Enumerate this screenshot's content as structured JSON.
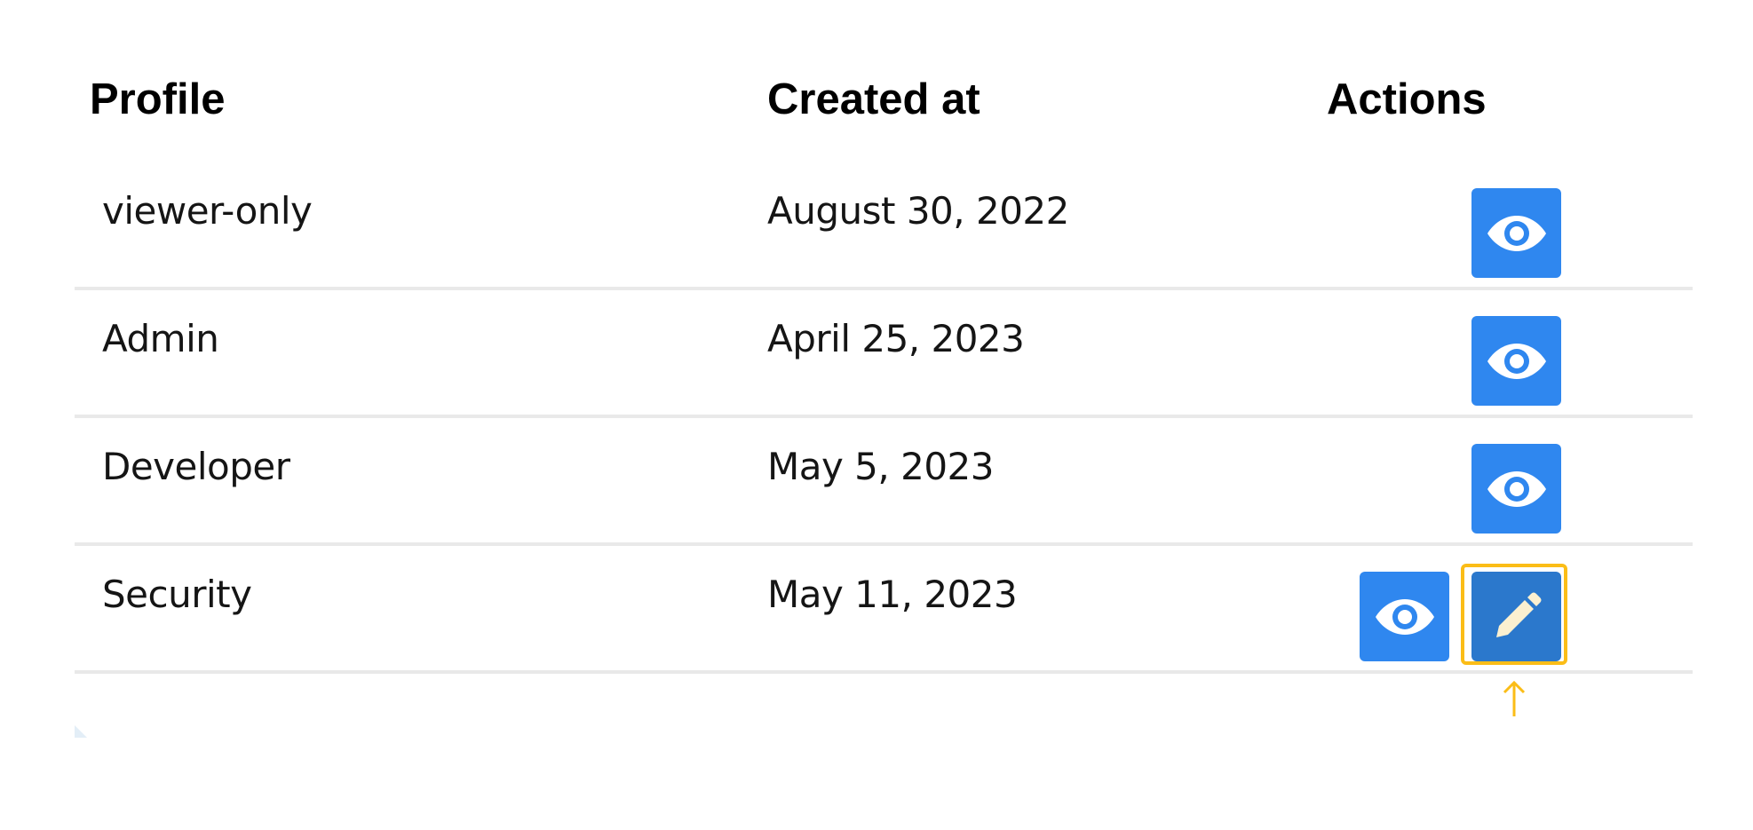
{
  "table": {
    "headers": {
      "profile": "Profile",
      "created_at": "Created at",
      "actions": "Actions"
    },
    "rows": [
      {
        "profile": "viewer-only",
        "created_at": "August 30, 2022",
        "actions": [
          "view"
        ]
      },
      {
        "profile": "Admin",
        "created_at": "April 25, 2023",
        "actions": [
          "view"
        ]
      },
      {
        "profile": "Developer",
        "created_at": "May 5, 2023",
        "actions": [
          "view"
        ]
      },
      {
        "profile": "Security",
        "created_at": "May 11, 2023",
        "actions": [
          "view",
          "edit"
        ]
      }
    ]
  },
  "icons": {
    "view": "eye-icon",
    "edit": "pencil-icon",
    "pointer": "arrow-up-icon"
  },
  "colors": {
    "view_button": "#2f87ef",
    "edit_button": "#2b78cc",
    "highlight": "#fbbd17",
    "divider": "#e9e9e9",
    "icon_fill": "#ffffff",
    "edit_icon_fill": "#fbf0d0"
  },
  "highlighted_action": "edit"
}
